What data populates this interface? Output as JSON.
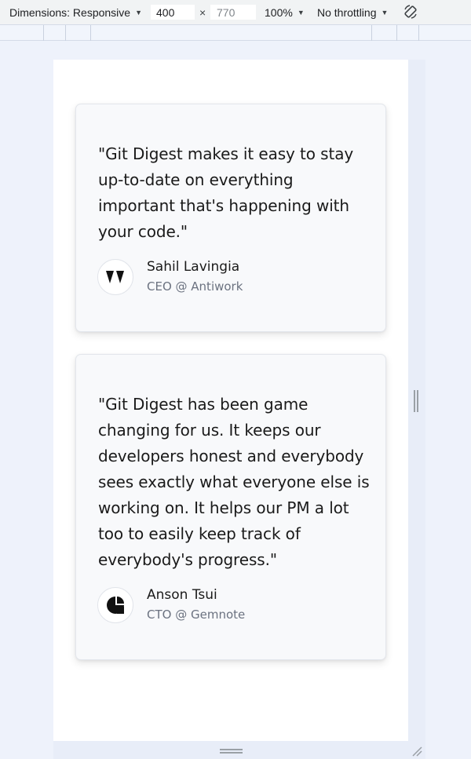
{
  "devtools": {
    "dimensions_label": "Dimensions: Responsive",
    "width_value": "400",
    "height_value": "770",
    "times_symbol": "×",
    "zoom_label": "100%",
    "throttling_label": "No throttling",
    "caret": "▼",
    "icons": [
      "chevron-down-icon",
      "rotate-icon",
      "resize-handle-icon"
    ]
  },
  "testimonials": [
    {
      "quote": "\"Git Digest makes it easy to stay up-to-date on everything important that's happening with your code.\"",
      "name": "Sahil Lavingia",
      "role": "CEO @ Antiwork",
      "logo_icon": "antiwork-logo-icon"
    },
    {
      "quote": "\"Git Digest has been game changing for us. It keeps our developers honest and everybody sees exactly what everyone else is working on. It helps our PM a lot too to easily keep track of everybody's progress.\"",
      "name": "Anson Tsui",
      "role": "CTO @ Gemnote",
      "logo_icon": "gemnote-logo-icon"
    }
  ],
  "colors": {
    "page_background": "#eef2fb",
    "card_background": "#f8f9fb",
    "text_primary": "#1a1a1a",
    "text_secondary": "#6b7280"
  }
}
